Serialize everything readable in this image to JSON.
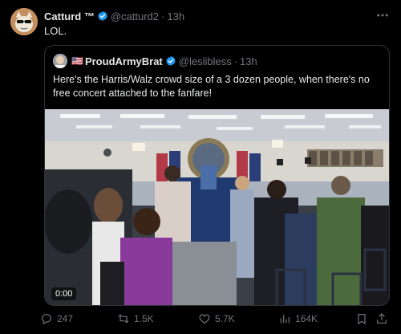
{
  "tweet": {
    "author_name": "Catturd ™",
    "handle": "@catturd2",
    "separator": "·",
    "time": "13h",
    "text": "LOL."
  },
  "quoted": {
    "flag": "🇺🇸",
    "author_name": "ProudArmyBrat",
    "handle": "@leslibless",
    "separator": "·",
    "time": "13h",
    "text": "Here's the Harris/Walz crowd size of a 3 dozen people, when there's no free concert attached to the fanfare!",
    "video_timecode": "0:00"
  },
  "actions": {
    "replies": "247",
    "reposts": "1.5K",
    "likes": "5.7K",
    "views": "164K"
  },
  "colors": {
    "background": "#000000",
    "text_primary": "#e7e9ea",
    "text_secondary": "#71767b",
    "verified": "#1d9bf0",
    "border": "#2f3336"
  },
  "icons": [
    "more-icon",
    "verified-badge-icon",
    "reply-icon",
    "repost-icon",
    "like-icon",
    "views-icon",
    "bookmark-icon",
    "share-icon"
  ]
}
